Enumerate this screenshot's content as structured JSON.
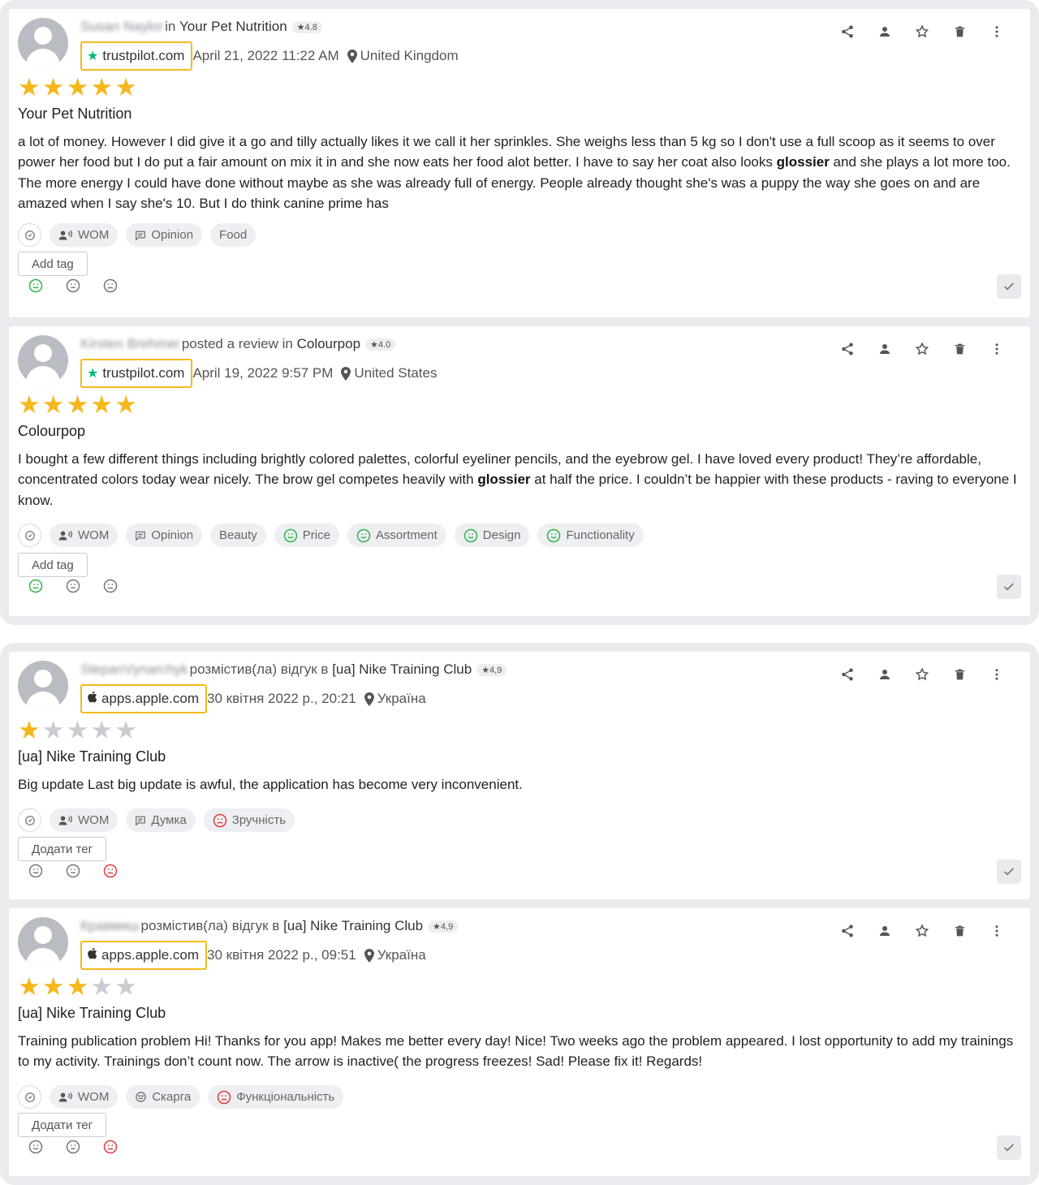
{
  "colors": {
    "accent_source": "#f2bb1b",
    "star": "#f6b71d",
    "trustpilot": "#00b67a",
    "positive": "#35b34a",
    "negative": "#e23d3d"
  },
  "actions": [
    "share-icon",
    "assign-user-icon",
    "favorite-icon",
    "delete-icon",
    "more-icon"
  ],
  "reviews": [
    {
      "author": "Susan Naylor",
      "posted_text": "in",
      "brand": "Your Pet Nutrition",
      "brand_rating": "★4.8",
      "source": "trustpilot.com",
      "source_icon": "trustpilot-star-icon",
      "date": "April 21, 2022 11:22 AM",
      "location": "United Kingdom",
      "rating": 5,
      "title": "Your Pet Nutrition",
      "text_parts": [
        "a lot of money. However I did give it a go and tilly actually likes it we call it her sprinkles. She weighs less than 5 kg so I don't use a full scoop as it seems to over power her food but I do put a fair amount on mix it in and she now eats her food alot better. I have to say her coat also looks ",
        "glossier",
        " and she plays a lot more too. The more energy I could have done without maybe as she was already full of energy. People already thought she's was a puppy the way she goes on and are amazed when I say she's 10. But I do think canine prime has"
      ],
      "tags": [
        {
          "label": "WOM",
          "icon": "wom-icon"
        },
        {
          "label": "Opinion",
          "icon": "comment-icon"
        },
        {
          "label": "Food",
          "icon": ""
        }
      ],
      "add_tag": "Add tag",
      "sentiment": "positive"
    },
    {
      "author": "Kirsten Brehmer",
      "posted_text": "posted a review in",
      "brand": "Colourpop",
      "brand_rating": "★4.0",
      "source": "trustpilot.com",
      "source_icon": "trustpilot-star-icon",
      "date": "April 19, 2022 9:57 PM",
      "location": "United States",
      "rating": 5,
      "title": "Colourpop",
      "text_parts": [
        "I bought a few different things including brightly colored palettes, colorful eyeliner pencils, and the eyebrow gel. I have loved every product! They’re affordable, concentrated colors today wear nicely. The brow gel competes heavily with ",
        "glossier",
        " at half the price. I couldn’t be happier with these products - raving to everyone I know."
      ],
      "tags": [
        {
          "label": "WOM",
          "icon": "wom-icon"
        },
        {
          "label": "Opinion",
          "icon": "comment-icon"
        },
        {
          "label": "Beauty",
          "icon": ""
        },
        {
          "label": "Price",
          "icon": "positive-face-icon"
        },
        {
          "label": "Assortment",
          "icon": "positive-face-icon"
        },
        {
          "label": "Design",
          "icon": "positive-face-icon"
        },
        {
          "label": "Functionality",
          "icon": "positive-face-icon"
        }
      ],
      "add_tag": "Add tag",
      "sentiment": "positive"
    },
    {
      "author": "StepanVynarchyk",
      "posted_text": "розмістив(ла) відгук в",
      "brand": "[ua] Nike Training Club",
      "brand_rating": "★4,9",
      "source": "apps.apple.com",
      "source_icon": "apple-icon",
      "date": "30 квітня 2022 р., 20:21",
      "location": "Україна",
      "rating": 1,
      "title": "[ua] Nike Training Club",
      "text_parts": [
        "Big update Last big update is awful, the application has become very inconvenient."
      ],
      "tags": [
        {
          "label": "WOM",
          "icon": "wom-icon"
        },
        {
          "label": "Думка",
          "icon": "comment-icon"
        },
        {
          "label": "Зручність",
          "icon": "negative-face-icon"
        }
      ],
      "add_tag": "Додати тег",
      "sentiment": "negative"
    },
    {
      "author": "Кравмиш",
      "posted_text": "розмістив(ла) відгук в",
      "brand": "[ua] Nike Training Club",
      "brand_rating": "★4,9",
      "source": "apps.apple.com",
      "source_icon": "apple-icon",
      "date": "30 квітня 2022 р., 09:51",
      "location": "Україна",
      "rating": 3,
      "title": "[ua] Nike Training Club",
      "text_parts": [
        "Training publication problem Hi! Thanks for you app! Makes me better every day! Nice! Two weeks ago the problem appeared. I lost opportunity to add my trainings to my activity. Trainings don’t count now. The arrow is inactive( the progress freezes! Sad! Please fix it! Regards!"
      ],
      "tags": [
        {
          "label": "WOM",
          "icon": "wom-icon"
        },
        {
          "label": "Скарга",
          "icon": "complaint-icon"
        },
        {
          "label": "Функціональність",
          "icon": "negative-face-icon"
        }
      ],
      "add_tag": "Додати тег",
      "sentiment": "negative"
    }
  ]
}
